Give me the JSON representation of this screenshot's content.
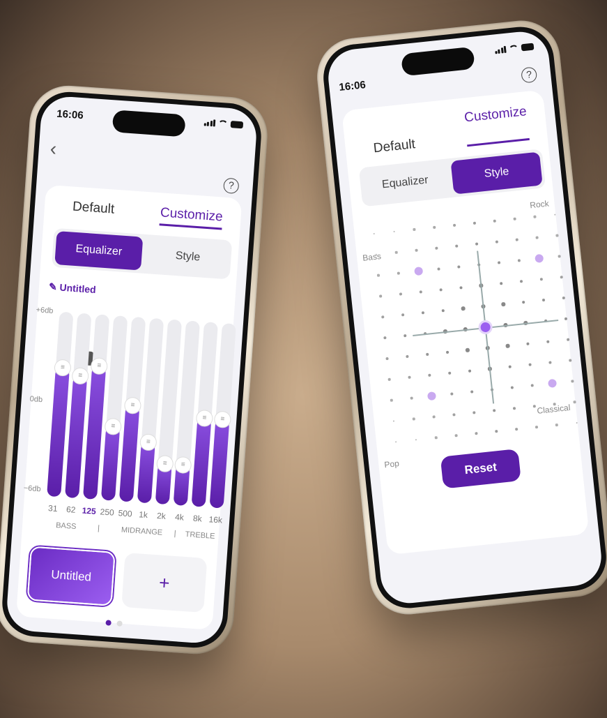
{
  "status": {
    "time": "16:06"
  },
  "tabs": {
    "default": "Default",
    "customize": "Customize"
  },
  "modes": {
    "equalizer": "Equalizer",
    "style": "Style"
  },
  "left": {
    "preset_name": "Untitled",
    "db_labels": [
      "+6db",
      "0db",
      "−6db"
    ],
    "bands": [
      {
        "freq": "31",
        "level": 0.7
      },
      {
        "freq": "62",
        "level": 0.66
      },
      {
        "freq": "125",
        "level": 0.72
      },
      {
        "freq": "250",
        "level": 0.4
      },
      {
        "freq": "500",
        "level": 0.52
      },
      {
        "freq": "1k",
        "level": 0.33
      },
      {
        "freq": "2k",
        "level": 0.22
      },
      {
        "freq": "4k",
        "level": 0.22
      },
      {
        "freq": "8k",
        "level": 0.48
      },
      {
        "freq": "16k",
        "level": 0.48
      }
    ],
    "tooltip_value": "3",
    "highlight_band": "125",
    "groups": {
      "bass": "BASS",
      "midrange": "MIDRANGE",
      "treble": "TREBLE",
      "divider": "|"
    },
    "presets": {
      "selected": "Untitled",
      "add": "+"
    }
  },
  "right": {
    "labels": {
      "rock": "Rock",
      "bass": "Bass",
      "classical": "Classical",
      "pop": "Pop"
    },
    "reset_label": "Reset"
  },
  "colors": {
    "accent": "#5a1ea8",
    "accent_light": "#9b5ef0"
  }
}
